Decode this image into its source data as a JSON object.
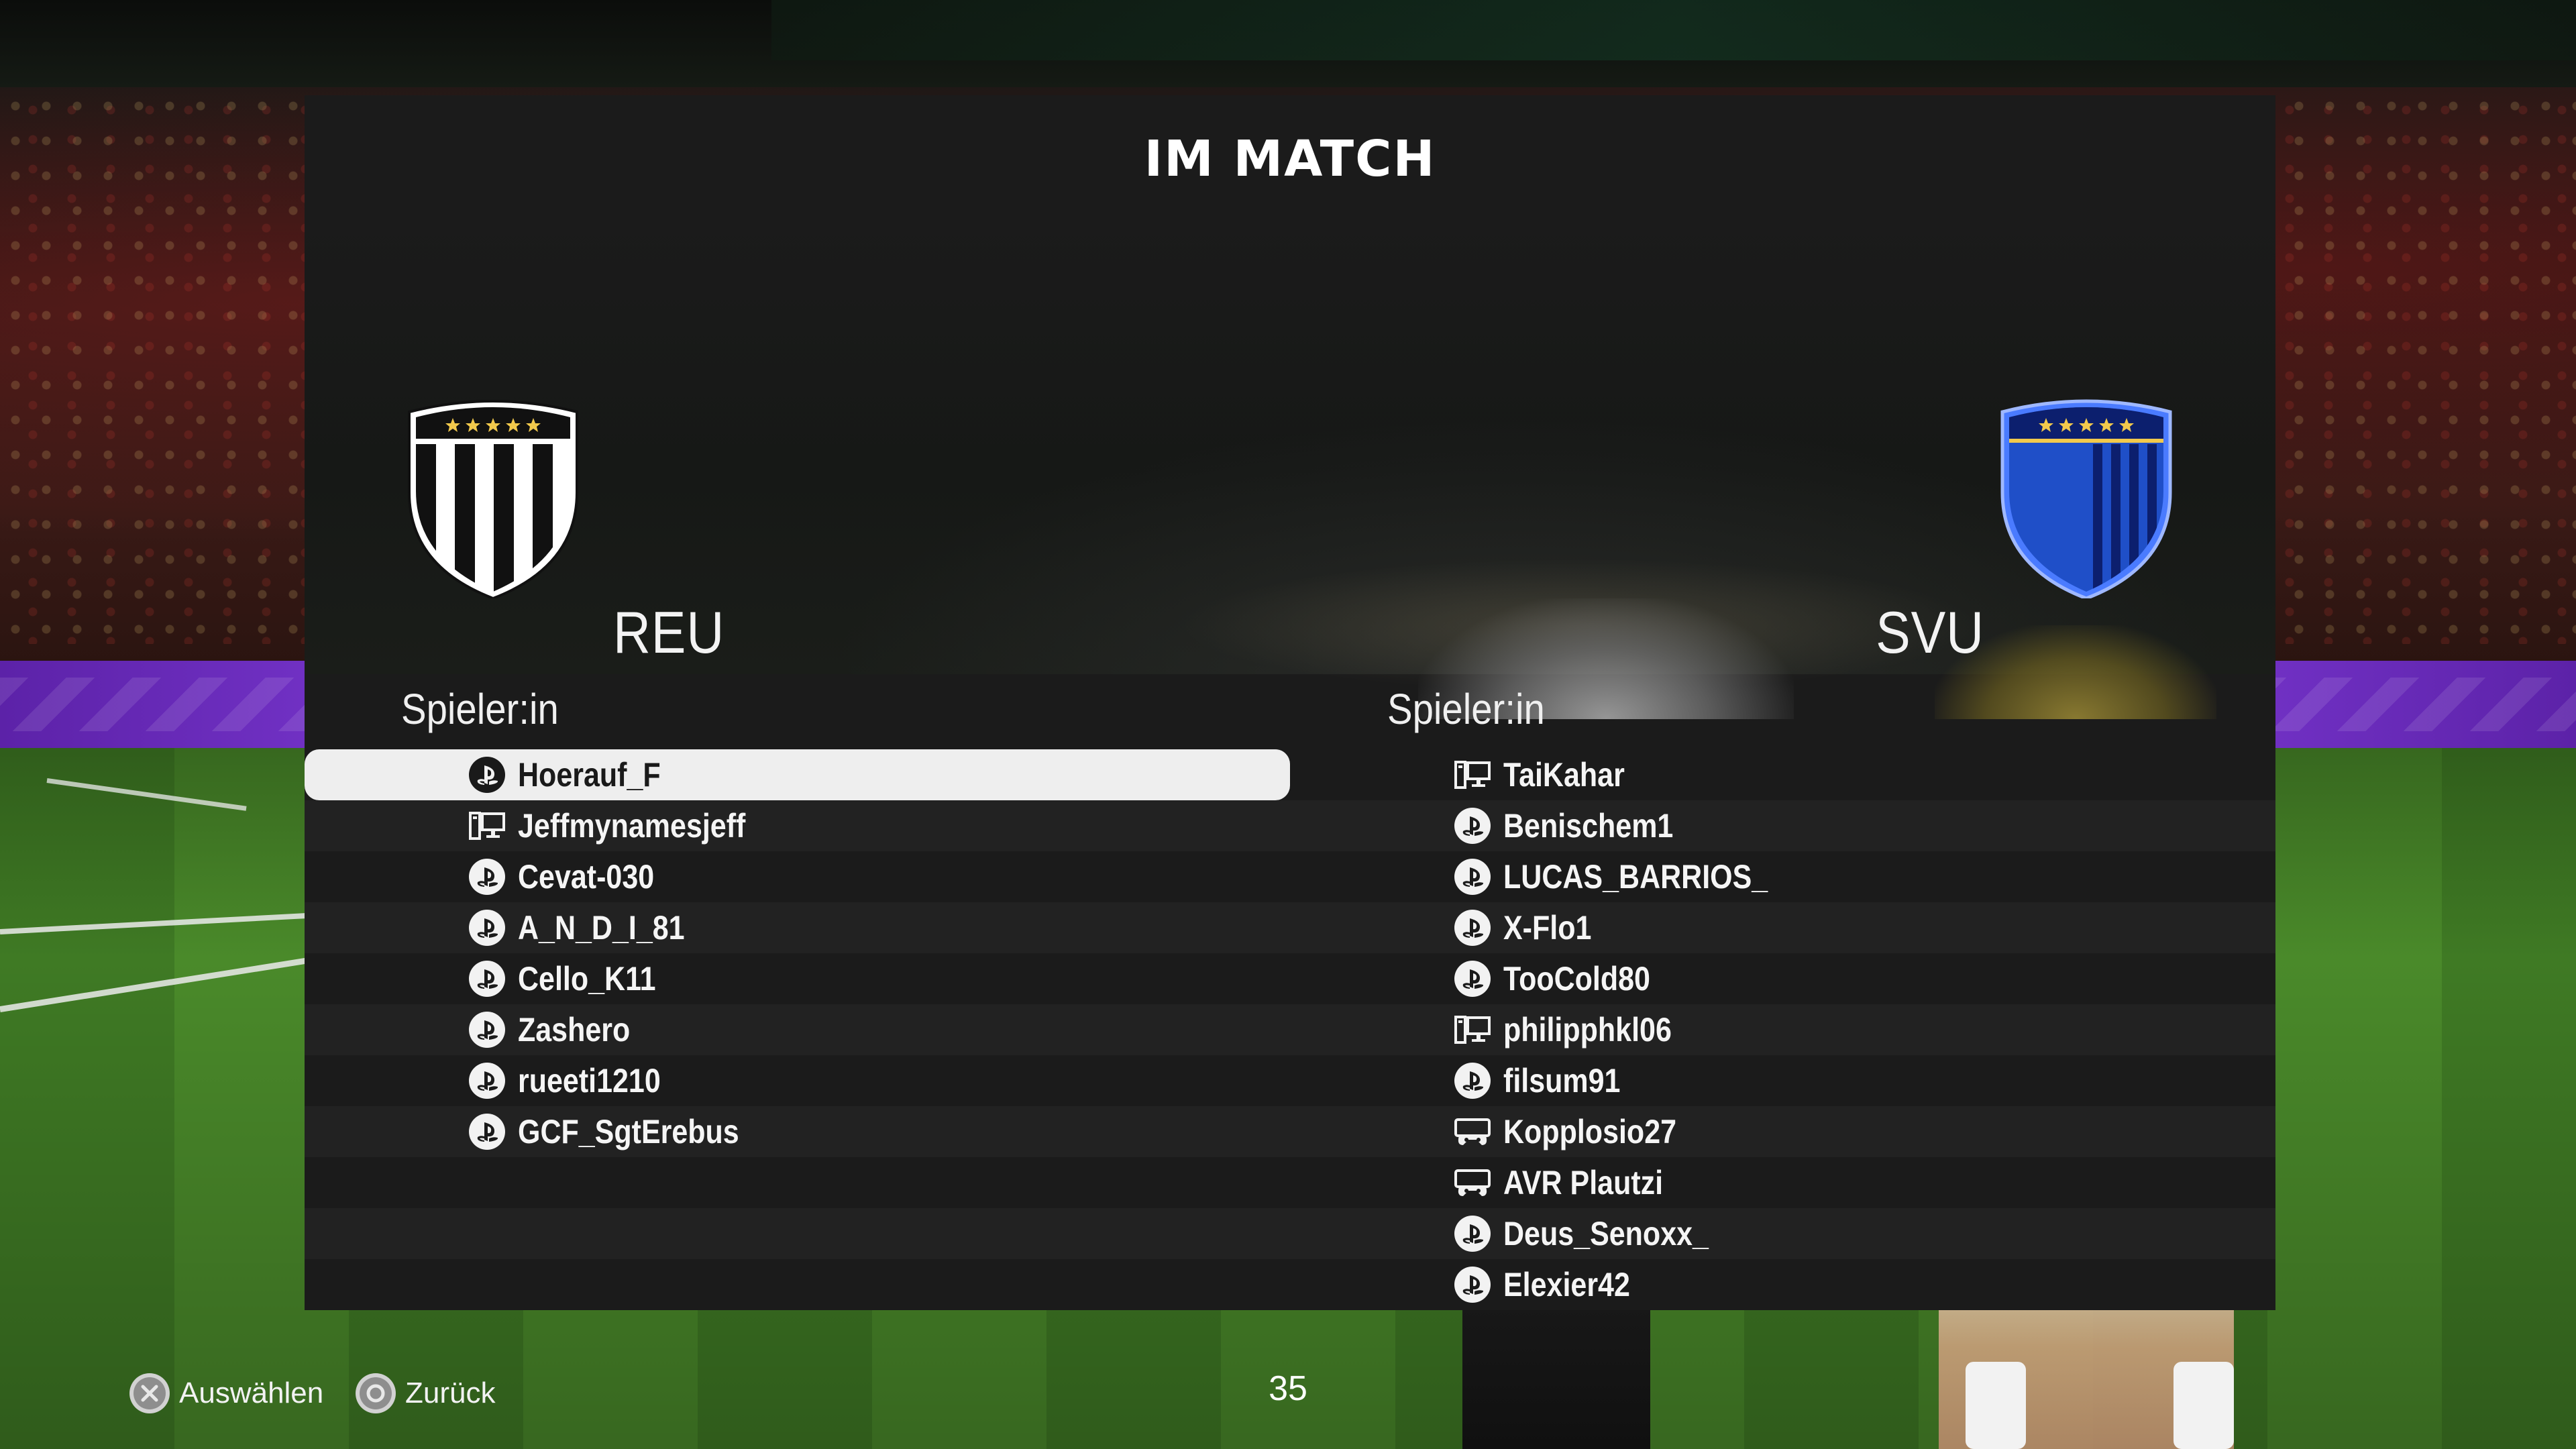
{
  "screen": {
    "title": "IM MATCH",
    "countdown": "35"
  },
  "home_team": {
    "name": "REU",
    "crest_icon": "black-white-striped-shield-crest-icon",
    "crest_colors": [
      "#111111",
      "#ffffff",
      "#f2c94c"
    ],
    "column_header": "Spieler:in",
    "players": [
      {
        "name": "Hoerauf_F",
        "platform": "playstation-icon",
        "selected": true
      },
      {
        "name": "Jeffmynamesjeff",
        "platform": "pc-icon",
        "selected": false
      },
      {
        "name": "Cevat-030",
        "platform": "playstation-icon",
        "selected": false
      },
      {
        "name": "A_N_D_I_81",
        "platform": "playstation-icon",
        "selected": false
      },
      {
        "name": "Cello_K11",
        "platform": "playstation-icon",
        "selected": false
      },
      {
        "name": "Zashero",
        "platform": "playstation-icon",
        "selected": false
      },
      {
        "name": "rueeti1210",
        "platform": "playstation-icon",
        "selected": false
      },
      {
        "name": "GCF_SgtErebus",
        "platform": "playstation-icon",
        "selected": false
      }
    ]
  },
  "away_team": {
    "name": "SVU",
    "crest_icon": "blue-striped-shield-crest-icon",
    "crest_colors": [
      "#1f4fc8",
      "#0c1f6e",
      "#f2c94c"
    ],
    "column_header": "Spieler:in",
    "players": [
      {
        "name": "TaiKahar",
        "platform": "pc-icon"
      },
      {
        "name": "Benischem1",
        "platform": "playstation-icon"
      },
      {
        "name": "LUCAS_BARRIOS_",
        "platform": "playstation-icon"
      },
      {
        "name": "X-Flo1",
        "platform": "playstation-icon"
      },
      {
        "name": "TooCold80",
        "platform": "playstation-icon"
      },
      {
        "name": "philipphkl06",
        "platform": "pc-icon"
      },
      {
        "name": "filsum91",
        "platform": "playstation-icon"
      },
      {
        "name": "Kopplosio27",
        "platform": "xbox-controller-icon"
      },
      {
        "name": "AVR Plautzi",
        "platform": "xbox-controller-icon"
      },
      {
        "name": "Deus_Senoxx_",
        "platform": "playstation-icon"
      },
      {
        "name": "Elexier42",
        "platform": "playstation-icon"
      }
    ]
  },
  "footer": {
    "select_label": "Auswählen",
    "select_icon": "cross-button-icon",
    "back_label": "Zurück",
    "back_icon": "circle-button-icon"
  }
}
